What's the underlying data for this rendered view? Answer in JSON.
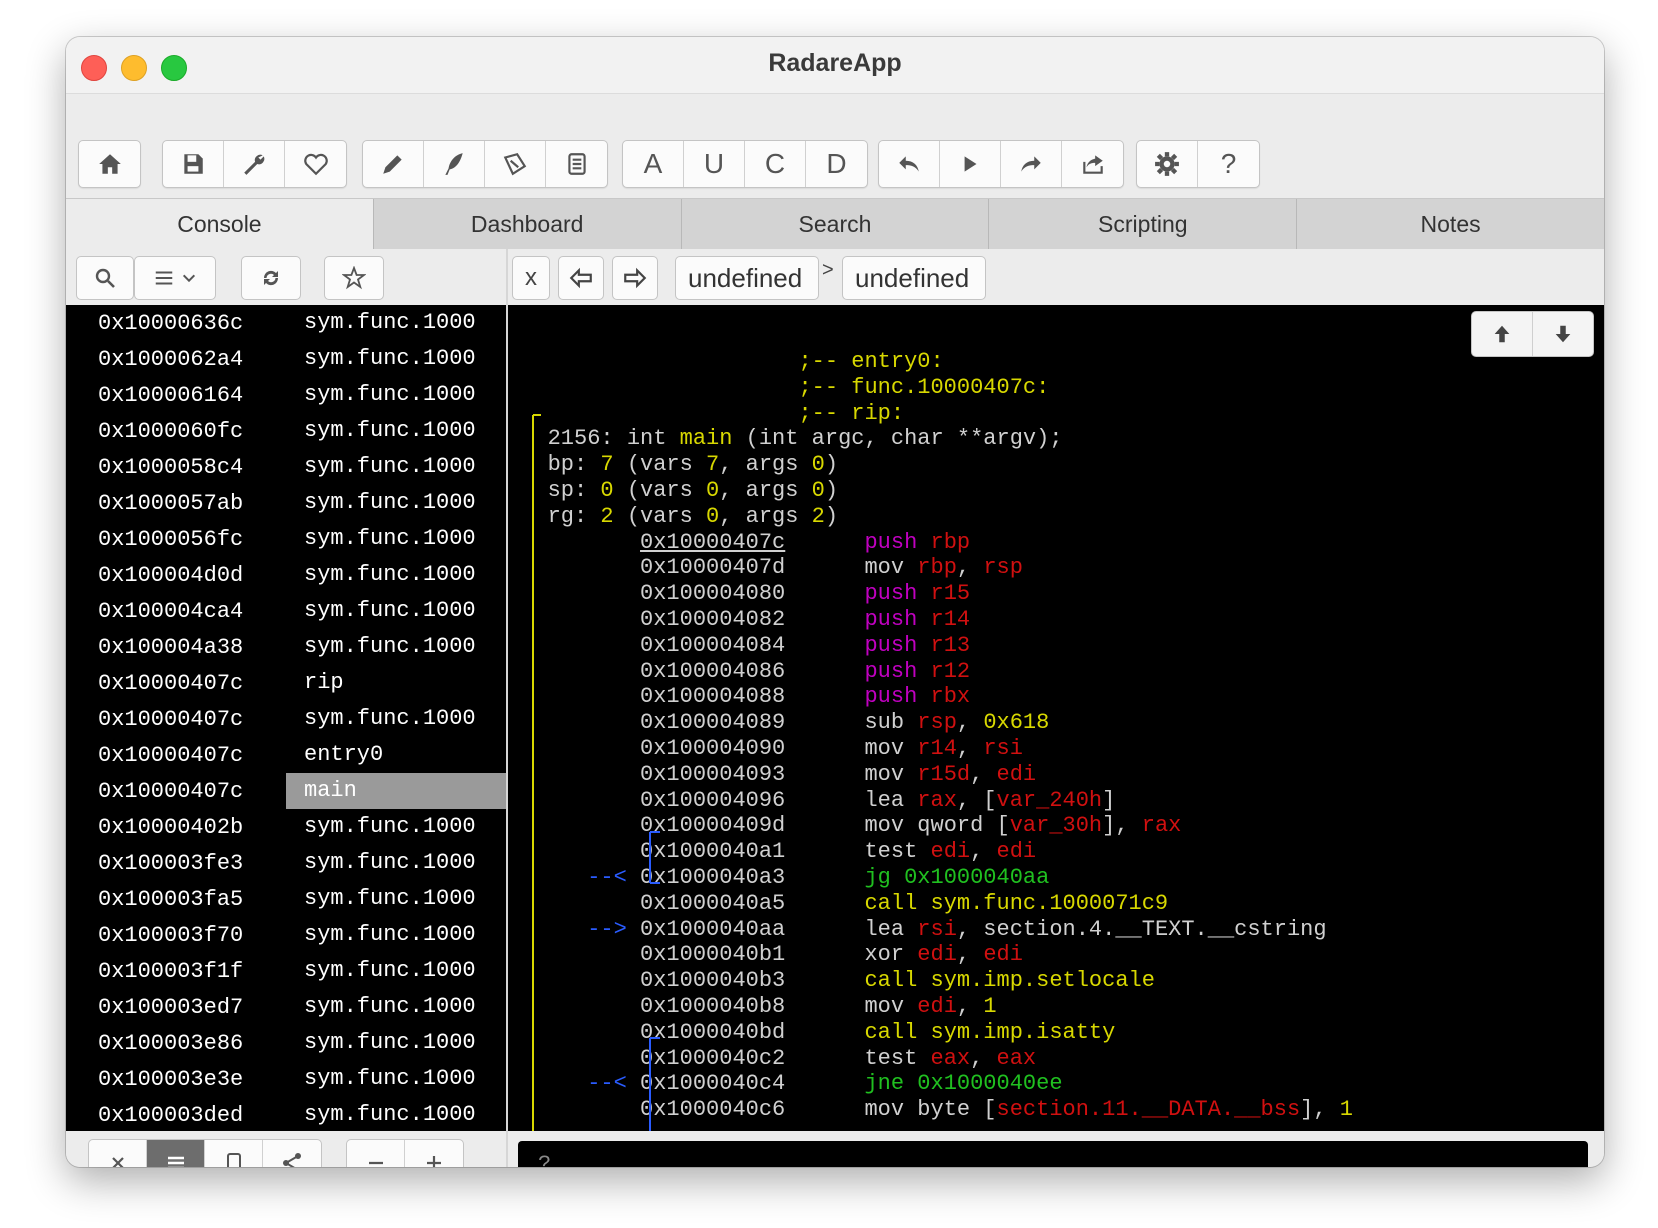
{
  "window": {
    "title": "RadareApp"
  },
  "toolbar": {
    "groups": [
      [
        {
          "icon": "home-icon"
        }
      ],
      [
        {
          "icon": "save-icon"
        },
        {
          "icon": "wrench-icon"
        },
        {
          "icon": "heart-icon"
        }
      ],
      [
        {
          "icon": "pencil-icon"
        },
        {
          "icon": "quill-icon"
        },
        {
          "icon": "stamp-icon"
        },
        {
          "icon": "notes-icon"
        }
      ],
      [
        {
          "label": "A"
        },
        {
          "label": "U"
        },
        {
          "label": "C"
        },
        {
          "label": "D"
        }
      ],
      [
        {
          "icon": "undo-icon"
        },
        {
          "icon": "play-icon"
        },
        {
          "icon": "redo-icon"
        },
        {
          "icon": "share-icon"
        }
      ],
      [
        {
          "icon": "gear-icon"
        },
        {
          "icon": "help-icon",
          "label": "?"
        }
      ]
    ]
  },
  "tabs": [
    {
      "label": "Console",
      "active": true
    },
    {
      "label": "Dashboard",
      "active": false
    },
    {
      "label": "Search",
      "active": false
    },
    {
      "label": "Scripting",
      "active": false
    },
    {
      "label": "Notes",
      "active": false
    }
  ],
  "nav": {
    "close_label": "x",
    "crumbs": [
      "undefined",
      "undefined"
    ],
    "separator": ">"
  },
  "sidebar": {
    "rows": [
      {
        "addr": "0x10000636c",
        "name": "sym.func.1000"
      },
      {
        "addr": "0x1000062a4",
        "name": "sym.func.1000"
      },
      {
        "addr": "0x100006164",
        "name": "sym.func.1000"
      },
      {
        "addr": "0x1000060fc",
        "name": "sym.func.1000"
      },
      {
        "addr": "0x1000058c4",
        "name": "sym.func.1000"
      },
      {
        "addr": "0x1000057ab",
        "name": "sym.func.1000"
      },
      {
        "addr": "0x1000056fc",
        "name": "sym.func.1000"
      },
      {
        "addr": "0x100004d0d",
        "name": "sym.func.1000"
      },
      {
        "addr": "0x100004ca4",
        "name": "sym.func.1000"
      },
      {
        "addr": "0x100004a38",
        "name": "sym.func.1000"
      },
      {
        "addr": "0x10000407c",
        "name": "rip"
      },
      {
        "addr": "0x10000407c",
        "name": "sym.func.1000"
      },
      {
        "addr": "0x10000407c",
        "name": "entry0"
      },
      {
        "addr": "0x10000407c",
        "name": "main",
        "selected": true
      },
      {
        "addr": "0x10000402b",
        "name": "sym.func.1000"
      },
      {
        "addr": "0x100003fe3",
        "name": "sym.func.1000"
      },
      {
        "addr": "0x100003fa5",
        "name": "sym.func.1000"
      },
      {
        "addr": "0x100003f70",
        "name": "sym.func.1000"
      },
      {
        "addr": "0x100003f1f",
        "name": "sym.func.1000"
      },
      {
        "addr": "0x100003ed7",
        "name": "sym.func.1000"
      },
      {
        "addr": "0x100003e86",
        "name": "sym.func.1000"
      },
      {
        "addr": "0x100003e3e",
        "name": "sym.func.1000"
      },
      {
        "addr": "0x100003ded",
        "name": "sym.func.1000"
      }
    ]
  },
  "disasm": {
    "header": [
      ";-- entry0:",
      ";-- func.10000407c:",
      ";-- rip:"
    ],
    "signature": {
      "prefix": "2156: int ",
      "name": "main",
      "suffix": " (int argc, char **argv);"
    },
    "bp": {
      "label": "bp: ",
      "value": "7",
      "rest_a": " (vars ",
      "vars": "7",
      "rest_b": ", args ",
      "args": "0",
      "end": ")"
    },
    "sp": {
      "label": "sp: ",
      "value": "0",
      "rest_a": " (vars ",
      "vars": "0",
      "rest_b": ", args ",
      "args": "0",
      "end": ")"
    },
    "rg": {
      "label": "rg: ",
      "value": "2",
      "rest_a": " (vars ",
      "vars": "0",
      "rest_b": ", args ",
      "args": "2",
      "end": ")"
    },
    "instructions": [
      {
        "addr": "0x10000407c",
        "parts": [
          [
            "m",
            "push "
          ],
          [
            "r",
            "rbp"
          ]
        ]
      },
      {
        "addr": "0x10000407d",
        "parts": [
          [
            "w",
            "mov "
          ],
          [
            "r",
            "rbp"
          ],
          [
            "w",
            ", "
          ],
          [
            "r",
            "rsp"
          ]
        ]
      },
      {
        "addr": "0x100004080",
        "parts": [
          [
            "m",
            "push "
          ],
          [
            "r",
            "r15"
          ]
        ]
      },
      {
        "addr": "0x100004082",
        "parts": [
          [
            "m",
            "push "
          ],
          [
            "r",
            "r14"
          ]
        ]
      },
      {
        "addr": "0x100004084",
        "parts": [
          [
            "m",
            "push "
          ],
          [
            "r",
            "r13"
          ]
        ]
      },
      {
        "addr": "0x100004086",
        "parts": [
          [
            "m",
            "push "
          ],
          [
            "r",
            "r12"
          ]
        ]
      },
      {
        "addr": "0x100004088",
        "parts": [
          [
            "m",
            "push "
          ],
          [
            "r",
            "rbx"
          ]
        ]
      },
      {
        "addr": "0x100004089",
        "parts": [
          [
            "w",
            "sub "
          ],
          [
            "r",
            "rsp"
          ],
          [
            "w",
            ", "
          ],
          [
            "y",
            "0x618"
          ]
        ]
      },
      {
        "addr": "0x100004090",
        "parts": [
          [
            "w",
            "mov "
          ],
          [
            "r",
            "r14"
          ],
          [
            "w",
            ", "
          ],
          [
            "r",
            "rsi"
          ]
        ]
      },
      {
        "addr": "0x100004093",
        "parts": [
          [
            "w",
            "mov "
          ],
          [
            "r",
            "r15d"
          ],
          [
            "w",
            ", "
          ],
          [
            "r",
            "edi"
          ]
        ]
      },
      {
        "addr": "0x100004096",
        "parts": [
          [
            "w",
            "lea "
          ],
          [
            "r",
            "rax"
          ],
          [
            "w",
            ", ["
          ],
          [
            "r",
            "var_240h"
          ],
          [
            "w",
            "]"
          ]
        ]
      },
      {
        "addr": "0x10000409d",
        "parts": [
          [
            "w",
            "mov qword ["
          ],
          [
            "r",
            "var_30h"
          ],
          [
            "w",
            "], "
          ],
          [
            "r",
            "rax"
          ]
        ]
      },
      {
        "addr": "0x1000040a1",
        "parts": [
          [
            "w",
            "test "
          ],
          [
            "r",
            "edi"
          ],
          [
            "w",
            ", "
          ],
          [
            "r",
            "edi"
          ]
        ]
      },
      {
        "addr": "0x1000040a3",
        "parts": [
          [
            "g",
            "jg 0x1000040aa"
          ]
        ],
        "arrow": "--<"
      },
      {
        "addr": "0x1000040a5",
        "parts": [
          [
            "y",
            "call sym.func.1000071c9"
          ]
        ]
      },
      {
        "addr": "0x1000040aa",
        "parts": [
          [
            "w",
            "lea "
          ],
          [
            "r",
            "rsi"
          ],
          [
            "w",
            ", section.4.__TEXT.__cstring"
          ]
        ],
        "arrow": "-->"
      },
      {
        "addr": "0x1000040b1",
        "parts": [
          [
            "w",
            "xor "
          ],
          [
            "r",
            "edi"
          ],
          [
            "w",
            ", "
          ],
          [
            "r",
            "edi"
          ]
        ]
      },
      {
        "addr": "0x1000040b3",
        "parts": [
          [
            "y",
            "call sym.imp.setlocale"
          ]
        ]
      },
      {
        "addr": "0x1000040b8",
        "parts": [
          [
            "w",
            "mov "
          ],
          [
            "r",
            "edi"
          ],
          [
            "w",
            ", "
          ],
          [
            "y",
            "1"
          ]
        ]
      },
      {
        "addr": "0x1000040bd",
        "parts": [
          [
            "y",
            "call sym.imp.isatty"
          ]
        ]
      },
      {
        "addr": "0x1000040c2",
        "parts": [
          [
            "w",
            "test "
          ],
          [
            "r",
            "eax"
          ],
          [
            "w",
            ", "
          ],
          [
            "r",
            "eax"
          ]
        ]
      },
      {
        "addr": "0x1000040c4",
        "parts": [
          [
            "g",
            "jne 0x1000040ee"
          ]
        ],
        "arrow": "--<"
      },
      {
        "addr": "0x1000040c6",
        "parts": [
          [
            "w",
            "mov byte ["
          ],
          [
            "r",
            "section.11.__DATA.__bss"
          ],
          [
            "w",
            "], "
          ],
          [
            "y",
            "1"
          ]
        ]
      }
    ]
  },
  "command": {
    "placeholder": "?"
  },
  "colors": {
    "selected_row": "#9a9a9a",
    "yellow": "#d8d800",
    "magenta": "#c000c0",
    "red": "#d01010",
    "green": "#20c020",
    "blue": "#2a5cff"
  }
}
